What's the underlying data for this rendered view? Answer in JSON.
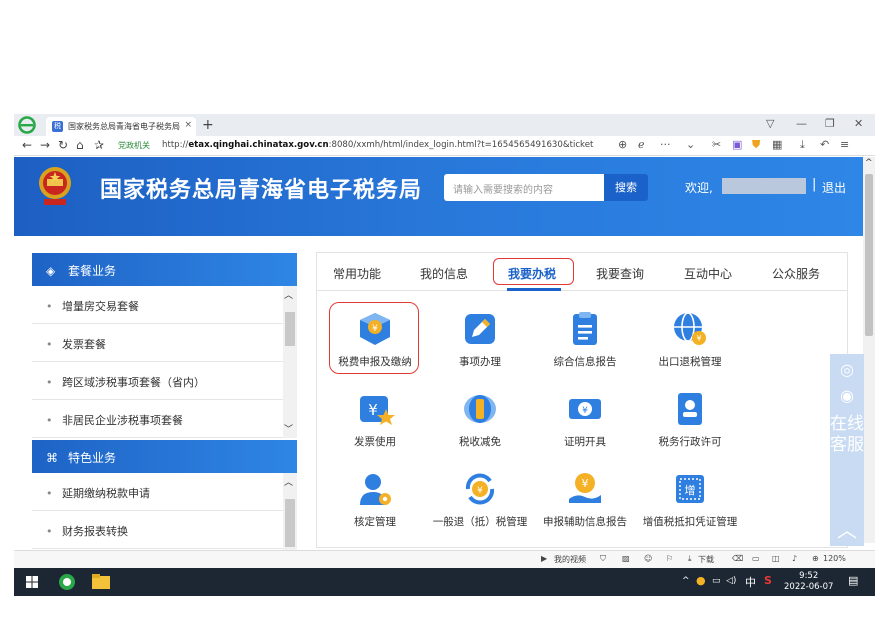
{
  "browser": {
    "tab_title": "国家税务总局青海省电子税务局",
    "tab_close": "×",
    "new_tab": "+",
    "url_prefix": "http://",
    "url_host": "etax.qinghai.chinatax.gov.cn",
    "url_rest": ":8080/xxmh/html/index_login.html?t=1654565491630&ticket",
    "gov_badge": "党政机关",
    "zoom": "120%",
    "status_items": [
      "我的视频",
      "下载"
    ]
  },
  "header": {
    "site_title": "国家税务总局青海省电子税务局",
    "search_placeholder": "请输入需要搜索的内容",
    "search_button": "搜索",
    "welcome": "欢迎,",
    "separator": "|",
    "logout": "退出"
  },
  "sidebar": {
    "package_title": "套餐业务",
    "package_items": [
      "增量房交易套餐",
      "发票套餐",
      "跨区域涉税事项套餐（省内）",
      "非居民企业涉税事项套餐"
    ],
    "feature_title": "特色业务",
    "feature_items": [
      "延期缴纳税款申请",
      "财务报表转换"
    ]
  },
  "main": {
    "tabs": [
      "常用功能",
      "我的信息",
      "我要办税",
      "我要查询",
      "互动中心",
      "公众服务"
    ],
    "active_tab": "我要办税",
    "functions": [
      {
        "label": "税费申报及缴纳",
        "icon": "tax-declare-icon"
      },
      {
        "label": "事项办理",
        "icon": "pencil-icon"
      },
      {
        "label": "综合信息报告",
        "icon": "clipboard-icon"
      },
      {
        "label": "出口退税管理",
        "icon": "globe-icon"
      },
      {
        "label": "发票使用",
        "icon": "invoice-icon"
      },
      {
        "label": "税收减免",
        "icon": "tax-relief-icon"
      },
      {
        "label": "证明开具",
        "icon": "certificate-icon"
      },
      {
        "label": "税务行政许可",
        "icon": "license-icon"
      },
      {
        "label": "核定管理",
        "icon": "user-gear-icon"
      },
      {
        "label": "一般退（抵）税管理",
        "icon": "refund-icon"
      },
      {
        "label": "申报辅助信息报告",
        "icon": "hand-coin-icon"
      },
      {
        "label": "增值税抵扣凭证管理",
        "icon": "vat-voucher-icon"
      }
    ]
  },
  "float_tools": {
    "kefu_text": "在线客服",
    "up_arrow": "︿"
  },
  "taskbar": {
    "ime": "中",
    "time": "9:52",
    "date": "2022-06-07"
  },
  "colors": {
    "brand_blue": "#1d5fc2",
    "accent_red": "#e53935"
  }
}
